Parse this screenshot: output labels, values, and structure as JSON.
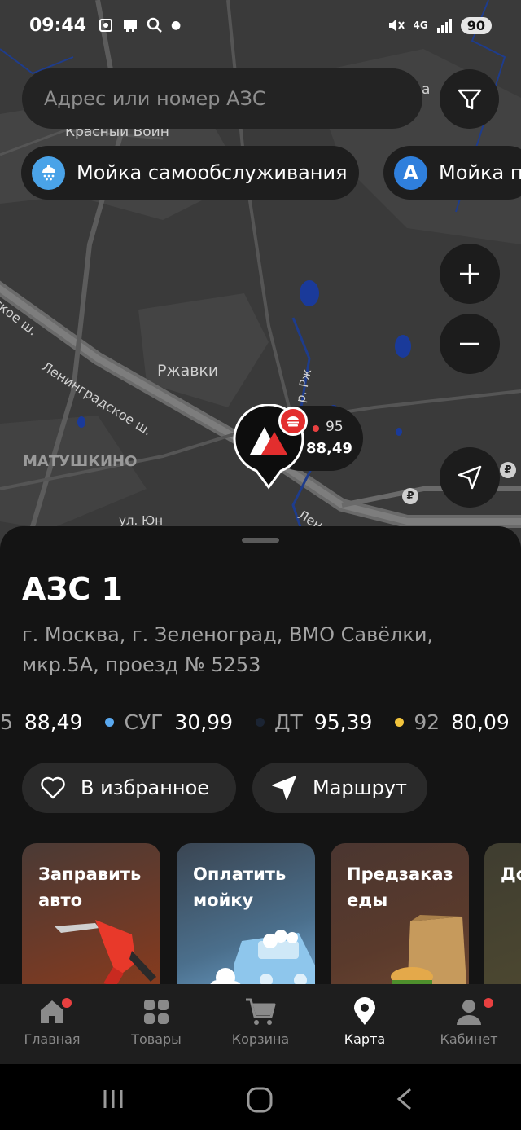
{
  "status_bar": {
    "time": "09:44",
    "network": "4G",
    "battery": "90"
  },
  "search": {
    "placeholder": "Адрес или номер АЗС"
  },
  "chips": [
    {
      "icon": "shower-icon",
      "label": "Мойка самообслуживания"
    },
    {
      "icon_letter": "A",
      "label": "Мойка п"
    }
  ],
  "map": {
    "labels": {
      "krasny_voin": "Красный Воин",
      "rzhavki": "Ржавки",
      "matushkino": "МАТУШКИНО",
      "leningradskoe_1": "Ленинградское ш.",
      "leningradskoe_2": "ское ш.",
      "river": "р. Рж",
      "road_bottom": "ул. Юн",
      "len_bottom": "Лен",
      "top_right": "а"
    },
    "station_marker": {
      "fuel": "95",
      "price": "88,49"
    },
    "rub_symbol": "₽"
  },
  "station": {
    "title": "АЗС 1",
    "address": "г. Москва, г. Зеленоград, ВМО Савёлки, мкр.5А, проезд № 5253"
  },
  "prices": [
    {
      "name": "5",
      "value": "88,49",
      "color": ""
    },
    {
      "name": "СУГ",
      "value": "30,99",
      "color": "#5aa9f0"
    },
    {
      "name": "ДТ",
      "value": "95,39",
      "color": "#1b2433"
    },
    {
      "name": "92",
      "value": "80,09",
      "color": "#f2c43c"
    }
  ],
  "actions": {
    "favorite": "В избранное",
    "route": "Маршрут"
  },
  "cards": [
    {
      "title_line1": "Заправить",
      "title_line2": "авто"
    },
    {
      "title_line1": "Оплатить",
      "title_line2": "мойку"
    },
    {
      "title_line1": "Предзаказ",
      "title_line2": "еды"
    },
    {
      "title_line1": "До",
      "title_line2": ""
    }
  ],
  "bottom_nav": [
    {
      "label": "Главная",
      "active": false
    },
    {
      "label": "Товары",
      "active": false
    },
    {
      "label": "Корзина",
      "active": false
    },
    {
      "label": "Карта",
      "active": true
    },
    {
      "label": "Кабинет",
      "active": false
    }
  ],
  "colors": {
    "accent_red": "#e84040",
    "chip_blue": "#2f8be0",
    "sheet_bg": "#141414"
  }
}
